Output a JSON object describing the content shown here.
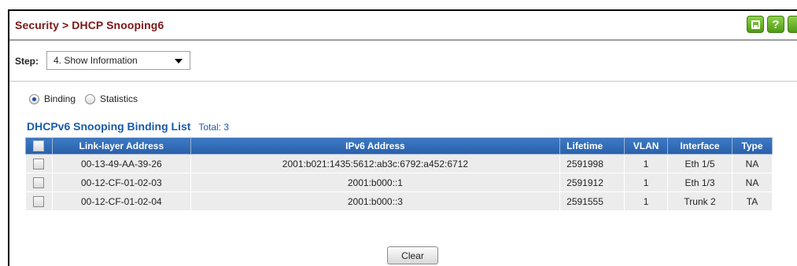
{
  "header": {
    "title": "Security > DHCP Snooping6",
    "icons": [
      "save-icon",
      "help-icon"
    ]
  },
  "step": {
    "label": "Step:",
    "selected": "4. Show Information"
  },
  "view": {
    "options": [
      {
        "label": "Binding",
        "checked": true
      },
      {
        "label": "Statistics",
        "checked": false
      }
    ]
  },
  "list": {
    "title": "DHCPv6 Snooping Binding List",
    "total": "Total: 3",
    "columns": [
      "Link-layer Address",
      "IPv6 Address",
      "Lifetime",
      "VLAN",
      "Interface",
      "Type"
    ],
    "rows": [
      {
        "mac": "00-13-49-AA-39-26",
        "ipv6": "2001:b021:1435:5612:ab3c:6792:a452:6712",
        "lifetime": "2591998",
        "vlan": "1",
        "interface": "Eth 1/5",
        "type": "NA"
      },
      {
        "mac": "00-12-CF-01-02-03",
        "ipv6": "2001:b000::1",
        "lifetime": "2591912",
        "vlan": "1",
        "interface": "Eth 1/3",
        "type": "NA"
      },
      {
        "mac": "00-12-CF-01-02-04",
        "ipv6": "2001:b000::3",
        "lifetime": "2591555",
        "vlan": "1",
        "interface": "Trunk 2",
        "type": "TA"
      }
    ]
  },
  "actions": {
    "clear_label": "Clear"
  },
  "colors": {
    "title": "#7a1818",
    "header_bg": "#2a5fa8",
    "list_title": "#1b5aa8",
    "icon_green": "#5aa81c"
  }
}
